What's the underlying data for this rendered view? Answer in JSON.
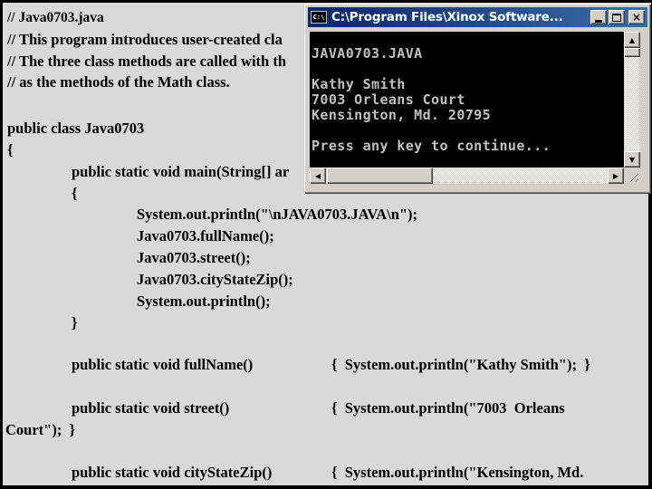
{
  "source_code": {
    "comments": [
      "// Java0703.java",
      "// This program introduces user-created cla",
      "// The three class methods are called with th",
      "// as the methods of the Math class."
    ],
    "class_decl": "public class Java0703",
    "class_open": "{",
    "main_decl": "public static void main(String[] ar",
    "main_open": "{",
    "main_body": [
      "System.out.println(\"\\nJAVA0703.JAVA\\n\");",
      "Java0703.fullName();",
      "Java0703.street();",
      "Java0703.cityStateZip();",
      "System.out.println();"
    ],
    "main_close": "}",
    "methods": [
      {
        "signature": "public static void fullName()",
        "body": "{  System.out.println(\"Kathy Smith\");  }",
        "wrap": ""
      },
      {
        "signature": "public static void street()",
        "body": "{  System.out.println(\"7003  Orleans",
        "wrap": "Court\");  }"
      },
      {
        "signature": "public static void cityStateZip()",
        "body": "{  System.out.println(\"Kensington, Md.",
        "wrap": ""
      }
    ]
  },
  "console_window": {
    "title": "C:\\Program Files\\Xinox Software...",
    "icon": "command-prompt-icon",
    "icon_text": "C:\\",
    "buttons": {
      "minimize": "minimize-icon",
      "maximize": "maximize-icon",
      "close": "×"
    },
    "output_lines": [
      "",
      "JAVA0703.JAVA",
      "",
      "Kathy Smith",
      "7003 Orleans Court",
      "Kensington, Md. 20795",
      "",
      "Press any key to continue..."
    ],
    "scroll_arrows": {
      "up": "▲",
      "down": "▼",
      "left": "◀",
      "right": "▶"
    }
  }
}
